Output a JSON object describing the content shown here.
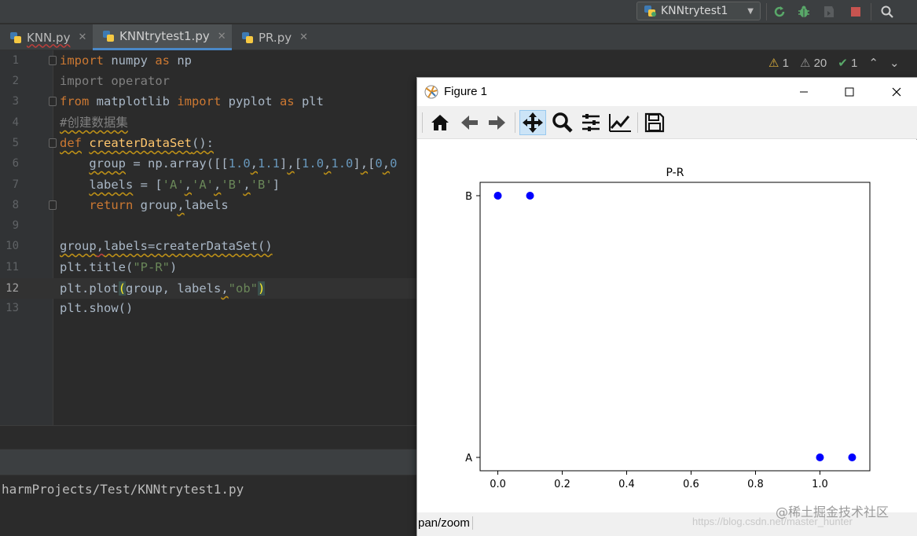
{
  "toolbar": {
    "run_config": "KNNtrytest1",
    "run_icon": "rerun-icon",
    "debug_icon": "debug-bug-icon",
    "coverage_icon": "coverage-shield-icon",
    "stop_icon": "stop-icon",
    "search_icon": "search-icon"
  },
  "tabs": [
    {
      "label": "KNN.py",
      "active": false
    },
    {
      "label": "KNNtrytest1.py",
      "active": true
    },
    {
      "label": "PR.py",
      "active": false
    }
  ],
  "inspections": {
    "errors": "1",
    "warnings": "20",
    "ok": "1"
  },
  "line_numbers": [
    "1",
    "2",
    "3",
    "4",
    "5",
    "6",
    "7",
    "8",
    "9",
    "10",
    "11",
    "12",
    "13"
  ],
  "code": {
    "l1": {
      "kw1": "import",
      "mod": " numpy ",
      "kw2": "as",
      "alias": " np"
    },
    "l2": "import operator",
    "l3": {
      "kw1": "from",
      "mod": " matplotlib ",
      "kw2": "import",
      "mid": " pyplot ",
      "kw3": "as",
      "alias": " plt"
    },
    "l4": "#创建数据集",
    "l5": {
      "kw": "def",
      "sp": " ",
      "fn": "createrDataSet",
      "rest": "():"
    },
    "l6": {
      "indent": "    ",
      "var": "group",
      "eq": " = np.array([[",
      "n1": "1.0",
      "c1": ",",
      "n2": "1.1",
      "b1": "]",
      "c2": ",",
      "b2": "[",
      "n3": "1.0",
      "c3": ",",
      "n4": "1.0",
      "b3": "]",
      "c4": ",",
      "b4": "[",
      "n5": "0",
      "c5": ",",
      "n6": "0"
    },
    "l7": {
      "indent": "    ",
      "var": "labels",
      "eq": " = [",
      "s1": "'A'",
      "c1": ",",
      "s2": "'A'",
      "c2": ",",
      "s3": "'B'",
      "c3": ",",
      "s4": "'B'",
      "end": "]"
    },
    "l8": {
      "indent": "    ",
      "kw": "return",
      "sp": " ",
      "a": "group",
      "c": ",",
      "b": "labels"
    },
    "l10": {
      "a": "group",
      "c": ",",
      "b": "labels=createrDataSet()"
    },
    "l11": {
      "pre": "plt.title(",
      "s": "\"P-R\"",
      "post": ")"
    },
    "l12": {
      "pre": "plt.plot",
      "po": "(",
      "a": "group, labels",
      "c": ",",
      "s": "\"ob\"",
      "pc": ")"
    },
    "l13": "plt.show()"
  },
  "console": {
    "path": "harmProjects/Test/KNNtrytest1.py"
  },
  "figure": {
    "title": "Figure 1",
    "window_icon": "matplotlib-logo-icon",
    "toolbar_icons": [
      "home-icon",
      "back-arrow-icon",
      "forward-arrow-icon",
      "pan-move-icon",
      "zoom-magnifier-icon",
      "subplots-config-icon",
      "edit-axis-icon",
      "save-icon"
    ],
    "status": "pan/zoom",
    "watermark": "https://blog.csdn.net/master_hunter",
    "watermark2": "@稀土掘金技术社区"
  },
  "chart_data": {
    "type": "scatter",
    "title": "P-R",
    "xlabel": "",
    "ylabel": "",
    "x": [
      1.0,
      1.0,
      0.0,
      0.1
    ],
    "y": [
      "A",
      "A",
      "B",
      "B"
    ],
    "points": [
      {
        "x": 1.0,
        "y": "A"
      },
      {
        "x": 1.1,
        "y": "A"
      },
      {
        "x": 0.0,
        "y": "B"
      },
      {
        "x": 0.1,
        "y": "B"
      }
    ],
    "y_categories": [
      "A",
      "B"
    ],
    "xlim": [
      -0.055,
      1.155
    ],
    "xticks": [
      "0.0",
      "0.2",
      "0.4",
      "0.6",
      "0.8",
      "1.0"
    ],
    "xtick_values": [
      0.0,
      0.2,
      0.4,
      0.6,
      0.8,
      1.0
    ],
    "marker": "o",
    "color": "#0000ff",
    "grid": false
  }
}
